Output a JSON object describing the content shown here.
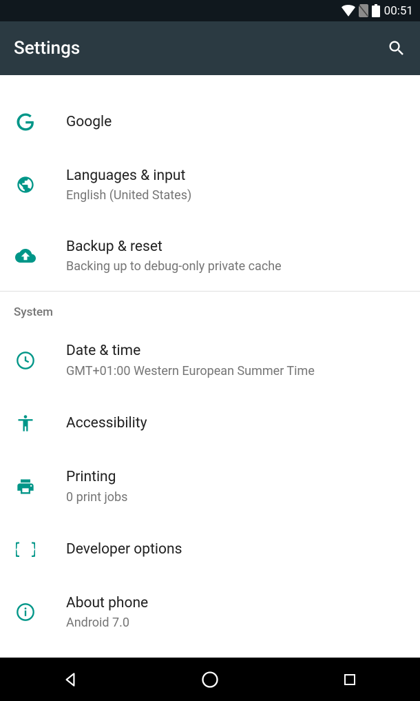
{
  "statusBar": {
    "time": "00:51"
  },
  "appBar": {
    "title": "Settings"
  },
  "items": {
    "google": {
      "title": "Google"
    },
    "languages": {
      "title": "Languages & input",
      "subtitle": "English (United States)"
    },
    "backup": {
      "title": "Backup & reset",
      "subtitle": "Backing up to debug-only private cache"
    },
    "datetime": {
      "title": "Date & time",
      "subtitle": "GMT+01:00 Western European Summer Time"
    },
    "accessibility": {
      "title": "Accessibility"
    },
    "printing": {
      "title": "Printing",
      "subtitle": "0 print jobs"
    },
    "developer": {
      "title": "Developer options"
    },
    "about": {
      "title": "About phone",
      "subtitle": "Android 7.0"
    }
  },
  "sections": {
    "system": "System"
  },
  "colors": {
    "accent": "#009688",
    "appBar": "#2b3a42",
    "statusBar": "#10181e"
  }
}
